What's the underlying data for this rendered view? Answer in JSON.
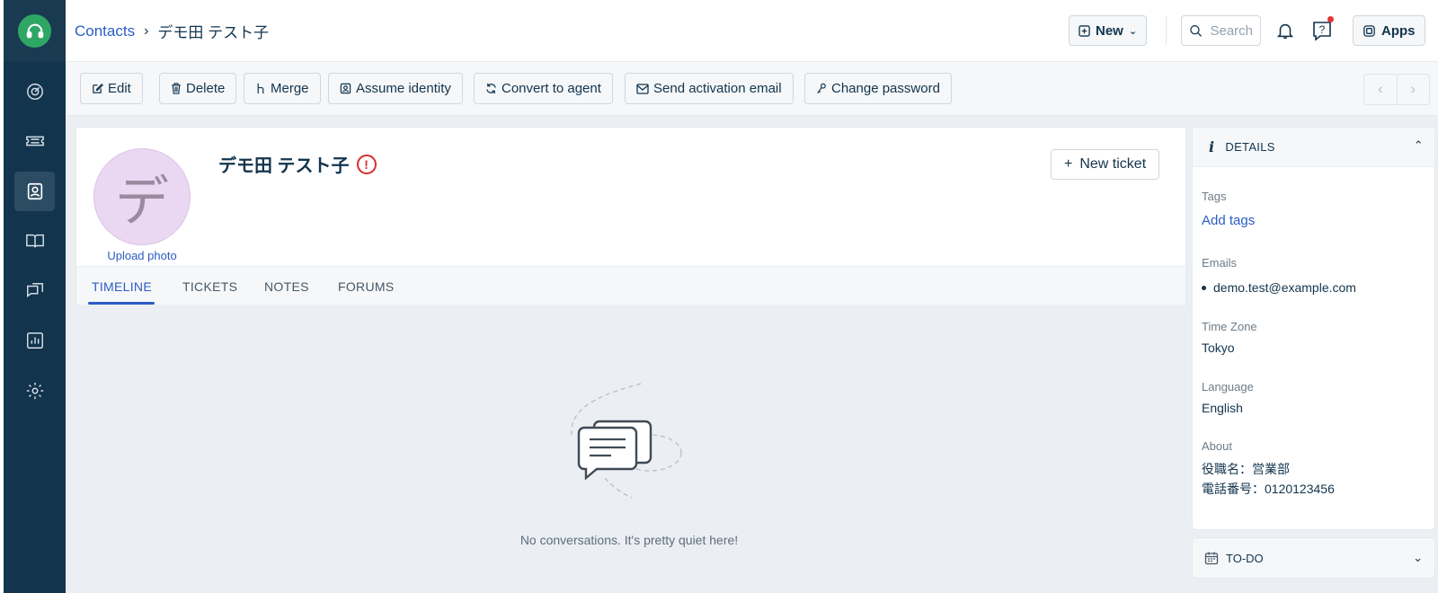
{
  "breadcrumb": {
    "parent": "Contacts",
    "separator": "›",
    "current": "デモ田 テスト子"
  },
  "topbar": {
    "new_label": "New",
    "search_placeholder": "Search",
    "apps_label": "Apps"
  },
  "actions": [
    "Edit",
    "Delete",
    "Merge",
    "Assume identity",
    "Convert to agent",
    "Send activation email",
    "Change password"
  ],
  "pager": {
    "prev": "‹",
    "next": "›"
  },
  "contact": {
    "avatar_letter": "デ",
    "upload_label": "Upload photo",
    "name": "デモ田 テスト子",
    "warning_symbol": "!",
    "new_ticket_label": "New ticket"
  },
  "tabs": [
    "TIMELINE",
    "TICKETS",
    "NOTES",
    "FORUMS"
  ],
  "active_tab": "TIMELINE",
  "empty_state": "No conversations. It's pretty quiet here!",
  "details": {
    "title": "DETAILS",
    "tags_label": "Tags",
    "tags_action": "Add tags",
    "emails_label": "Emails",
    "email": "demo.test@example.com",
    "timezone_label": "Time Zone",
    "timezone": "Tokyo",
    "language_label": "Language",
    "language": "English",
    "about_label": "About",
    "about_line1": "役職名：営業部",
    "about_line2": "電話番号：0120123456"
  },
  "todo": {
    "title": "TO-DO"
  },
  "colors": {
    "sidebar": "#12344d",
    "accent": "#2c5cc5",
    "logo": "#2ea764",
    "avatar_bg": "#ead7f2",
    "warning": "#d72d30"
  }
}
